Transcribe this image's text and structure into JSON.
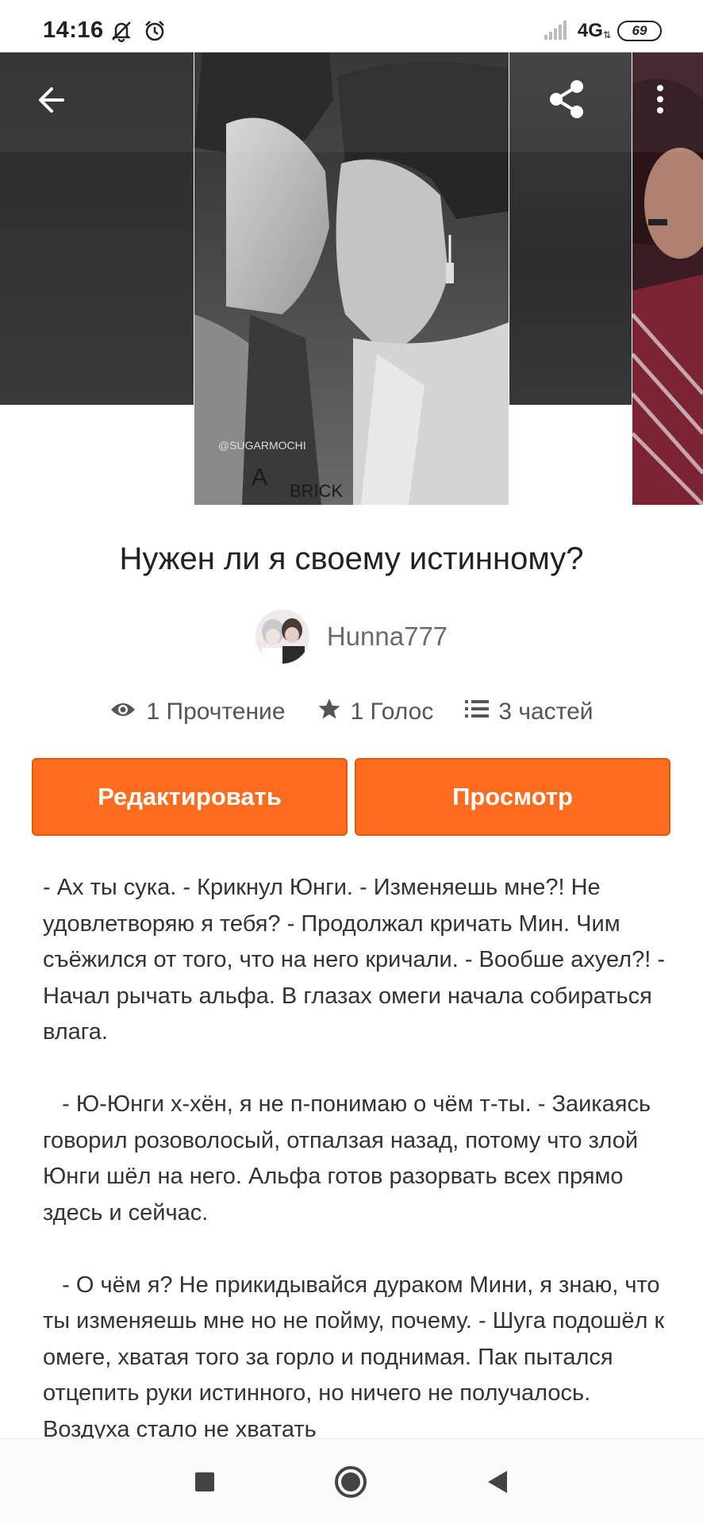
{
  "status_bar": {
    "time": "14:16",
    "icons": [
      "notifications-muted-icon",
      "alarm-icon",
      "signal-icon"
    ],
    "network": "4G",
    "battery": "69"
  },
  "toolbar": {
    "back_icon": "arrow-left-icon",
    "share_icon": "share-icon",
    "more_icon": "more-vertical-icon"
  },
  "cover": {
    "caption_1": "@SUGARMOCHI",
    "caption_2": "A",
    "caption_3": "BRICK"
  },
  "story": {
    "title": "Нужен ли я своему истинному?",
    "author": "Hunna777"
  },
  "stats": {
    "reads": "1 Прочтение",
    "votes": "1 Голос",
    "parts": "3 частей"
  },
  "actions": {
    "edit_label": "Редактировать",
    "view_label": "Просмотр"
  },
  "body": {
    "text": "- Ах ты сука. - Крикнул Юнги. - Изменяешь мне?! Не удовлетворяю я тебя? - Продолжал кричать Мин. Чим съёжился от того, что на него кричали. - Вообше ахуел?! - Начал рычать альфа. В глазах омеги начала собираться влага.\n\n   - Ю-Юнги х-хён, я не п-понимаю о чём т-ты. - Заикаясь говорил розоволосый, отпалзая назад, потому что злой Юнги шёл на него. Альфа готов разорвать всех прямо здесь и сейчас.\n\n   - О чём я? Не прикидывайся дураком Мини, я знаю, что ты изменяешь мне но не пойму, почему. - Шуга подошёл к омеге, хватая того за горло и поднимая. Пак пытался отцепить руки истинного, но ничего не получалось. Воздуха стало не хватать"
  },
  "system_nav": {
    "recents_icon": "square-icon",
    "home_icon": "circle-icon",
    "back_icon": "triangle-back-icon"
  },
  "colors": {
    "accent": "#ff6b1f",
    "accent_border": "#e8560c"
  }
}
